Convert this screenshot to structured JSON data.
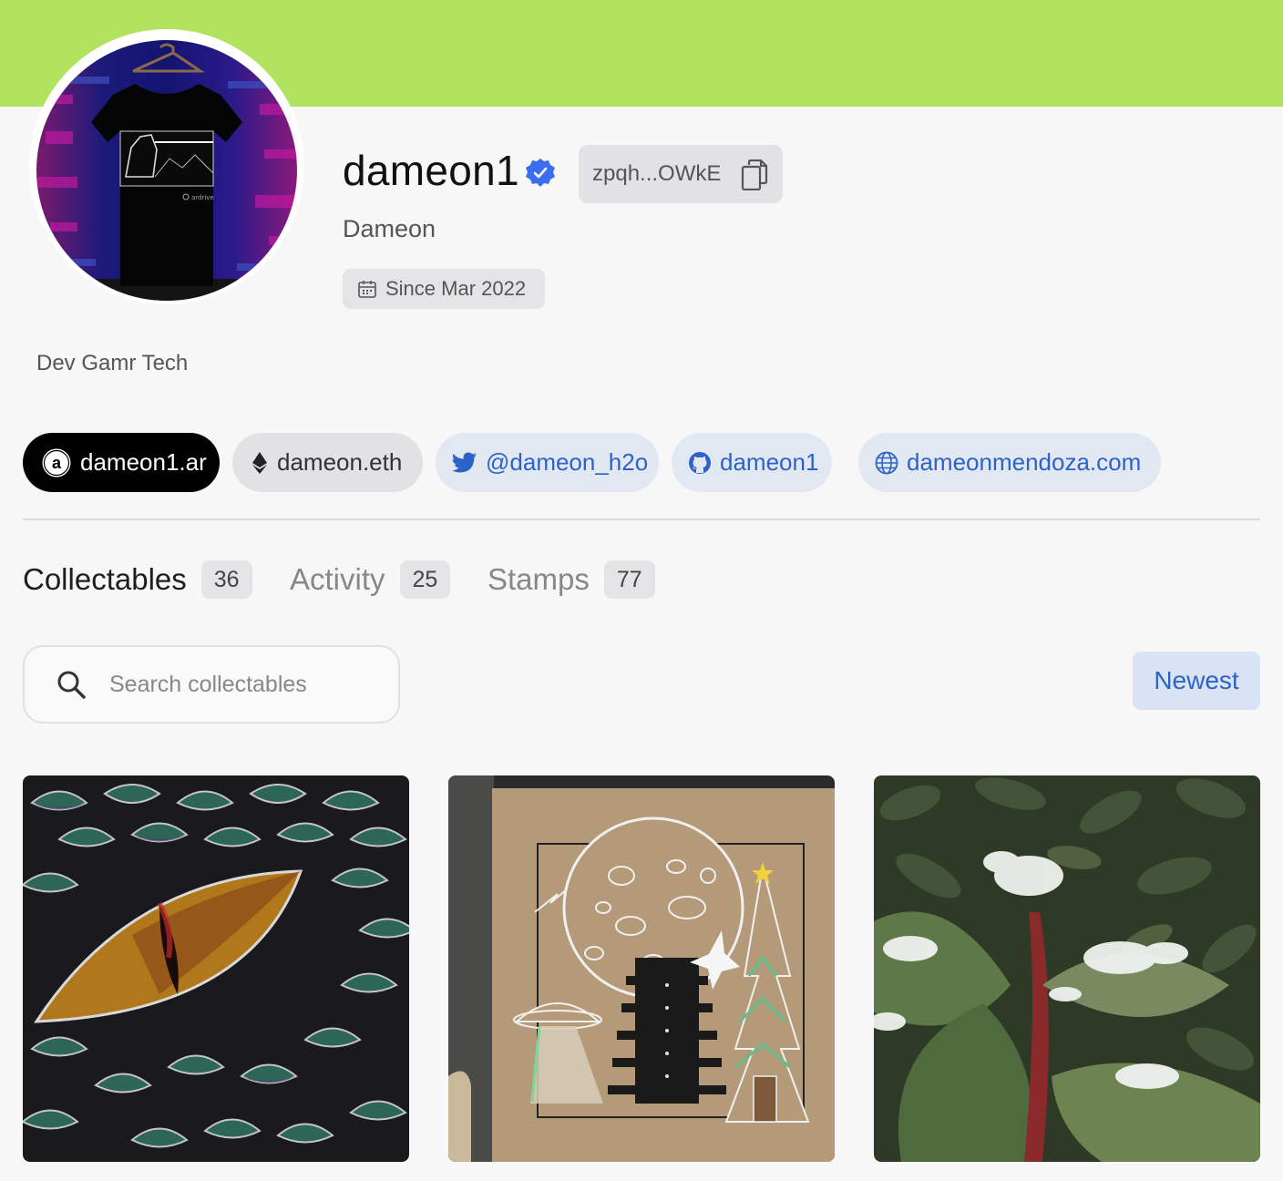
{
  "colors": {
    "banner": "#b2e35f",
    "accent_blue": "#2d63c8",
    "verified_blue": "#3b6df0"
  },
  "profile": {
    "username": "dameon1",
    "verified": true,
    "address": "zpqh...OWkE",
    "display_name": "Dameon",
    "since": "Since Mar 2022",
    "bio": "Dev Gamr Tech",
    "avatar_shirt_text": "ardrive"
  },
  "links": [
    {
      "icon": "arweave-icon",
      "label": "dameon1.ar"
    },
    {
      "icon": "ethereum-icon",
      "label": "dameon.eth"
    },
    {
      "icon": "twitter-icon",
      "label": "@dameon_h2o"
    },
    {
      "icon": "github-icon",
      "label": "dameon1"
    },
    {
      "icon": "globe-icon",
      "label": "dameonmendoza.com"
    }
  ],
  "tabs": [
    {
      "label": "Collectables",
      "count": "36",
      "active": true
    },
    {
      "label": "Activity",
      "count": "25",
      "active": false
    },
    {
      "label": "Stamps",
      "count": "77",
      "active": false
    }
  ],
  "search": {
    "placeholder": "Search collectables",
    "value": ""
  },
  "sort": {
    "label": "Newest"
  },
  "collectables": [
    {
      "subject": "dragon-eye-drawing"
    },
    {
      "subject": "moon-tower-ufo-drawing"
    },
    {
      "subject": "snowy-leaves-photo"
    }
  ]
}
